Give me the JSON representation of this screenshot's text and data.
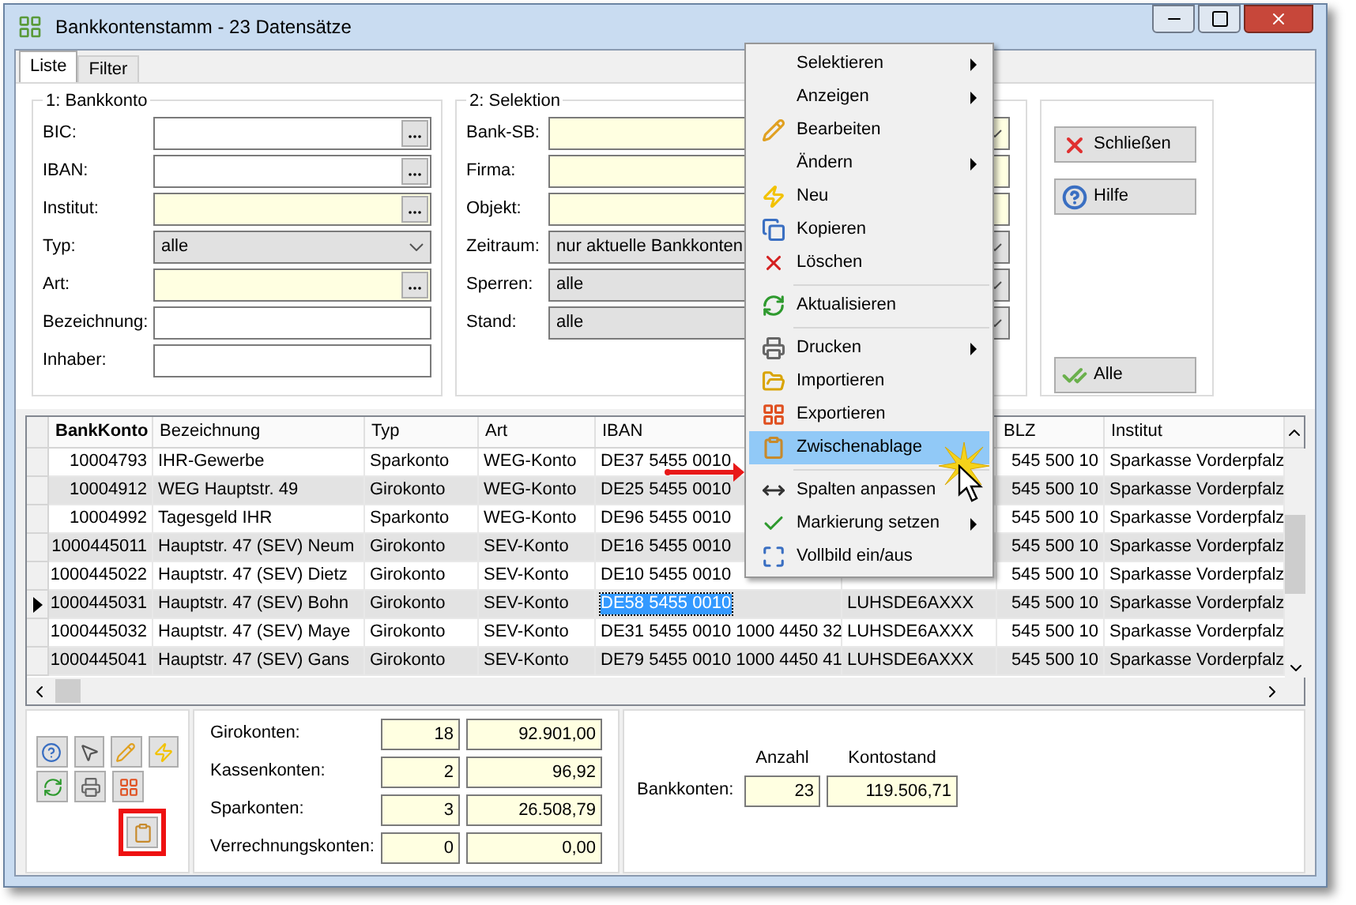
{
  "window": {
    "title": "Bankkontenstamm - 23 Datensätze"
  },
  "tabs": [
    {
      "label": "Liste",
      "selected": true
    },
    {
      "label": "Filter",
      "selected": false
    }
  ],
  "bankkonto_group": {
    "title": "1: Bankkonto",
    "fields": [
      {
        "label": "BIC:",
        "kind": "lookup",
        "required": false
      },
      {
        "label": "IBAN:",
        "kind": "lookup",
        "required": false
      },
      {
        "label": "Institut:",
        "kind": "lookup",
        "required": true
      },
      {
        "label": "Typ:",
        "kind": "select",
        "value": "alle"
      },
      {
        "label": "Art:",
        "kind": "lookup",
        "required": true
      },
      {
        "label": "Bezeichnung:",
        "kind": "text",
        "required": false
      },
      {
        "label": "Inhaber:",
        "kind": "text",
        "required": false
      }
    ]
  },
  "selektion_group": {
    "title": "2: Selektion",
    "fields": [
      {
        "label": "Bank-SB:",
        "kind": "select",
        "required": true
      },
      {
        "label": "Firma:",
        "kind": "text",
        "required": true
      },
      {
        "label": "Objekt:",
        "kind": "text",
        "required": true
      },
      {
        "label": "Zeitraum:",
        "kind": "select",
        "value": "nur aktuelle Bankkonten"
      },
      {
        "label": "Sperren:",
        "kind": "select",
        "value": "alle"
      },
      {
        "label": "Stand:",
        "kind": "select",
        "value": "alle"
      }
    ]
  },
  "action_buttons": [
    {
      "label": "Schließen"
    },
    {
      "label": "Hilfe"
    },
    {
      "label": "Alle"
    }
  ],
  "table": {
    "columns": {
      "bankkonto": "BankKonto",
      "bezeichnung": "Bezeichnung",
      "typ": "Typ",
      "art": "Art",
      "iban": "IBAN",
      "blz": "BLZ",
      "institut": "Institut"
    },
    "rows": [
      {
        "bankkonto": "10004793",
        "bezeichnung": "IHR-Gewerbe",
        "typ": "Sparkonto",
        "art": "WEG-Konto",
        "iban": "DE37 5455 0010",
        "blz": "545 500 10",
        "institut": "Sparkasse Vorderpfalz",
        "selected": false
      },
      {
        "bankkonto": "10004912",
        "bezeichnung": "WEG Hauptstr. 49",
        "typ": "Girokonto",
        "art": "WEG-Konto",
        "iban": "DE25 5455 0010",
        "blz": "545 500 10",
        "institut": "Sparkasse Vorderpfalz",
        "selected": false
      },
      {
        "bankkonto": "10004992",
        "bezeichnung": "Tagesgeld IHR",
        "typ": "Sparkonto",
        "art": "WEG-Konto",
        "iban": "DE96 5455 0010",
        "blz": "545 500 10",
        "institut": "Sparkasse Vorderpfalz",
        "selected": false
      },
      {
        "bankkonto": "1000445011",
        "bezeichnung": "Hauptstr. 47 (SEV) Neum",
        "typ": "Girokonto",
        "art": "SEV-Konto",
        "iban": "DE16 5455 0010",
        "blz": "545 500 10",
        "institut": "Sparkasse Vorderpfalz",
        "selected": false
      },
      {
        "bankkonto": "1000445022",
        "bezeichnung": "Hauptstr. 47 (SEV) Dietz",
        "typ": "Girokonto",
        "art": "SEV-Konto",
        "iban": "DE10 5455 0010",
        "blz": "545 500 10",
        "institut": "Sparkasse Vorderpfalz",
        "selected": false
      },
      {
        "bankkonto": "1000445031",
        "bezeichnung": "Hauptstr. 47 (SEV) Bohn",
        "typ": "Girokonto",
        "art": "SEV-Konto",
        "iban": "DE58 5455 0010",
        "column_6": "LUHSDE6AXXX",
        "blz": "545 500 10",
        "institut": "Sparkasse Vorderpfalz",
        "selected": true
      },
      {
        "bankkonto": "1000445032",
        "bezeichnung": "Hauptstr. 47 (SEV) Maye",
        "typ": "Girokonto",
        "art": "SEV-Konto",
        "iban": "DE31 5455 0010 1000 4450 32",
        "column_6": "LUHSDE6AXXX",
        "blz": "545 500 10",
        "institut": "Sparkasse Vorderpfalz",
        "selected": false
      },
      {
        "bankkonto": "1000445041",
        "bezeichnung": "Hauptstr. 47 (SEV) Gans",
        "typ": "Girokonto",
        "art": "SEV-Konto",
        "iban": "DE79 5455 0010 1000 4450 41",
        "column_6": "LUHSDE6AXXX",
        "blz": "545 500 10",
        "institut": "Sparkasse Vorderpfalz",
        "selected": false
      }
    ]
  },
  "context_menu": {
    "items": [
      {
        "kind": "item",
        "label": "Selektieren",
        "submenu": true,
        "selected": false
      },
      {
        "kind": "item",
        "label": "Anzeigen",
        "submenu": true,
        "selected": false
      },
      {
        "kind": "item",
        "label": "Bearbeiten",
        "submenu": false,
        "selected": false
      },
      {
        "kind": "item",
        "label": "Ändern",
        "submenu": true,
        "selected": false
      },
      {
        "kind": "item",
        "label": "Neu",
        "submenu": false,
        "selected": false
      },
      {
        "kind": "item",
        "label": "Kopieren",
        "submenu": false,
        "selected": false
      },
      {
        "kind": "item",
        "label": "Löschen",
        "submenu": false,
        "selected": false
      },
      {
        "kind": "separator"
      },
      {
        "kind": "item",
        "label": "Aktualisieren",
        "submenu": false,
        "selected": false
      },
      {
        "kind": "separator"
      },
      {
        "kind": "item",
        "label": "Drucken",
        "submenu": true,
        "selected": false
      },
      {
        "kind": "item",
        "label": "Importieren",
        "submenu": false,
        "selected": false
      },
      {
        "kind": "item",
        "label": "Exportieren",
        "submenu": false,
        "selected": false
      },
      {
        "kind": "item",
        "label": "Zwischenablage",
        "submenu": false,
        "selected": true
      },
      {
        "kind": "separator"
      },
      {
        "kind": "item",
        "label": "Spalten anpassen",
        "submenu": false,
        "selected": false
      },
      {
        "kind": "item",
        "label": "Markierung setzen",
        "submenu": true,
        "selected": false
      },
      {
        "kind": "item",
        "label": "Vollbild ein/aus",
        "submenu": false,
        "selected": false
      }
    ]
  },
  "summary": {
    "rows": [
      {
        "label": "Girokonten:",
        "count": "18",
        "amount": "92.901,00"
      },
      {
        "label": "Kassenkonten:",
        "count": "2",
        "amount": "96,92"
      },
      {
        "label": "Sparkonten:",
        "count": "3",
        "amount": "26.508,79"
      },
      {
        "label": "Verrechnungskonten:",
        "count": "0",
        "amount": "0,00"
      }
    ]
  },
  "totals": {
    "count_heading": "Anzahl",
    "amount_heading": "Kontostand",
    "label": "Bankkonten:",
    "count": "23",
    "amount": "119.506,71"
  }
}
